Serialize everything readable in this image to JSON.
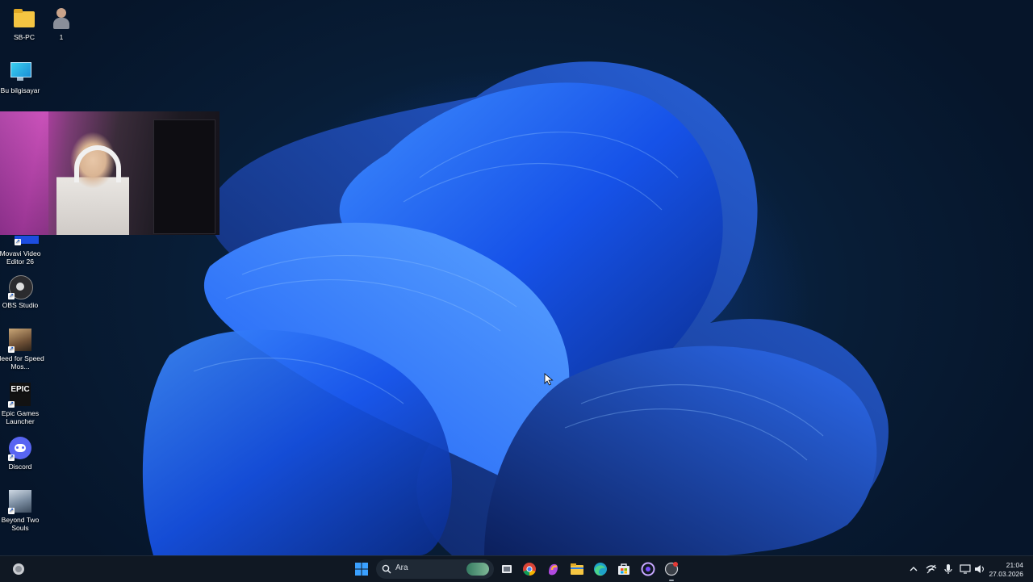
{
  "desktop": {
    "icons": [
      {
        "label": "SB-PC",
        "icon": "folder-icon"
      },
      {
        "label": "1",
        "icon": "user-photo-icon"
      },
      {
        "label": "Bu bilgisayar",
        "icon": "monitor-icon"
      },
      {
        "label": "Movavi Video Editor 26",
        "icon": "movavi-icon"
      },
      {
        "label": "OBS Studio",
        "icon": "obs-icon"
      },
      {
        "label": "Need for Speed Mos...",
        "icon": "nfs-icon"
      },
      {
        "label": "Epic Games Launcher",
        "icon": "epic-games-icon"
      },
      {
        "label": "Discord",
        "icon": "discord-icon"
      },
      {
        "label": "Beyond Two Souls",
        "icon": "beyond-two-souls-icon"
      }
    ]
  },
  "epic_logo_text": "EPIC",
  "taskbar": {
    "search_placeholder": "Ara",
    "pinned": [
      "start-icon",
      "search-icon",
      "widgets-icon",
      "task-view-icon",
      "chrome-icon",
      "copilot-icon",
      "file-explorer-icon",
      "edge-icon",
      "store-icon",
      "browser-icon",
      "app-icon"
    ],
    "tray": {
      "time": "21:04",
      "date": "27.03.2026"
    }
  },
  "colors": {
    "wallpaper_bg": "#06182c",
    "bloom": "#1f6cff",
    "taskbar": "#101823"
  }
}
